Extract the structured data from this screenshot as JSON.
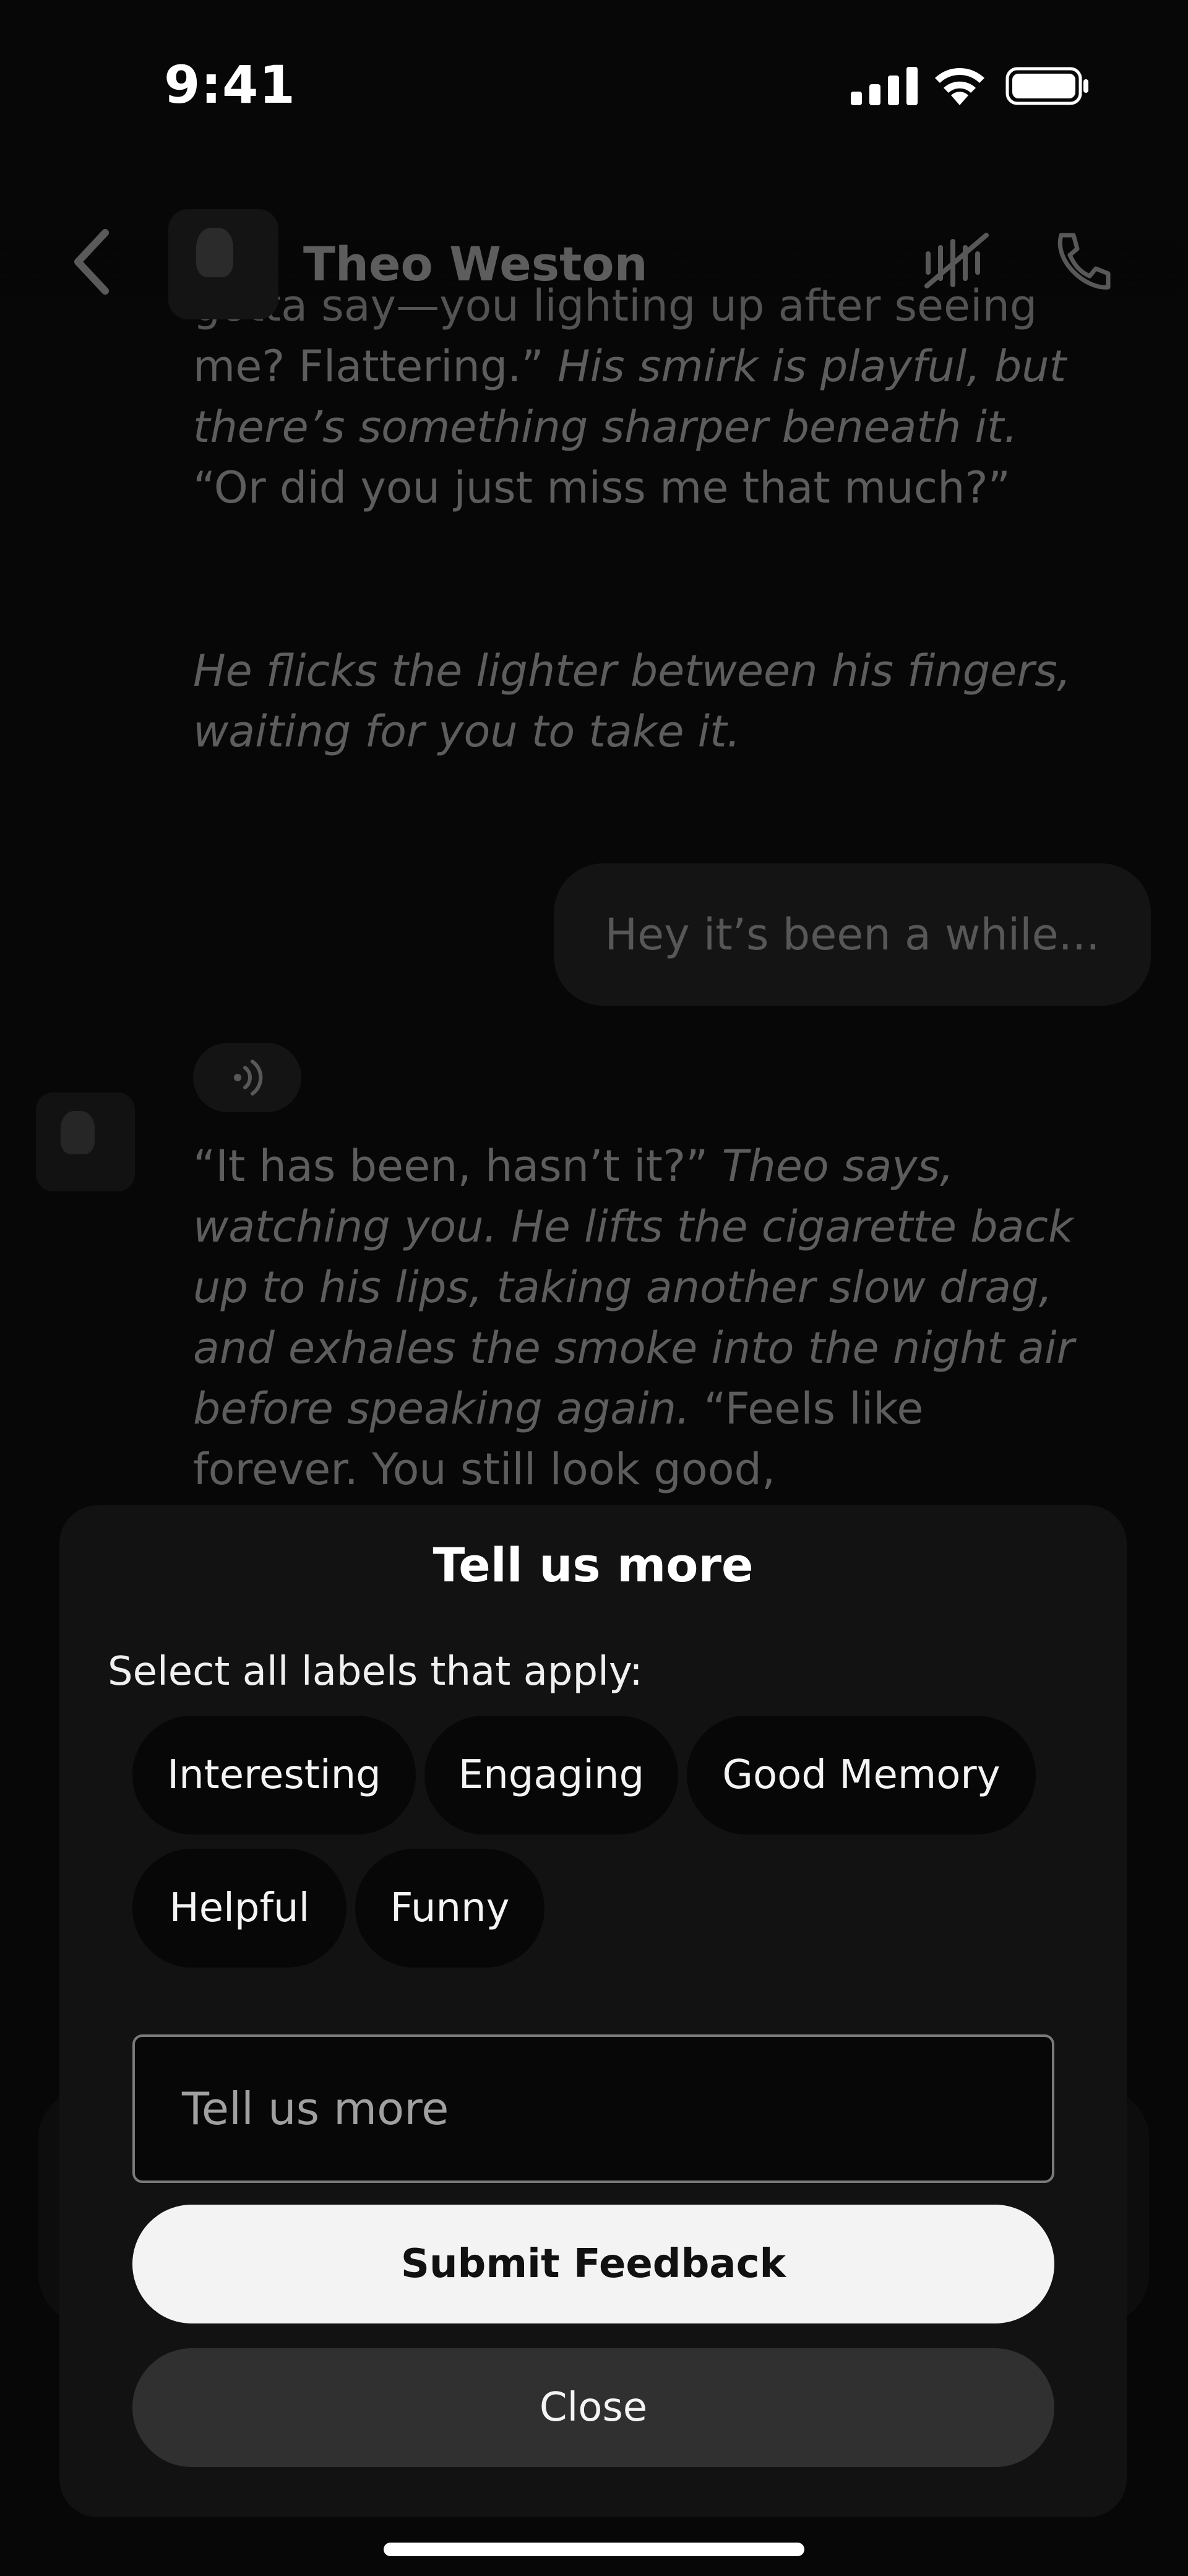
{
  "status_bar": {
    "time": "9:41",
    "icons": [
      "signal-icon",
      "wifi-icon",
      "battery-icon"
    ]
  },
  "header": {
    "back_icon": "chevron-left-icon",
    "name": "Theo Weston",
    "actions": [
      "mute-voice-icon",
      "phone-call-icon"
    ]
  },
  "chat": {
    "msg1_clip": "gotta say—you lighting up after seeing",
    "msg1_a": "me? Flattering.”",
    "msg1_b": "His smirk is playful, but there’s something sharper beneath it.",
    "msg1_c": "“Or did you just miss me that much?”",
    "msg2": "He flicks the lighter between his fingers, waiting for you to take it.",
    "user_message": "Hey it’s been a while...",
    "msg3_a": "“It has been, hasn’t it?”",
    "msg3_b": "Theo says, watching you. He lifts the cigarette back up to his lips, taking another slow drag, and exhales the smoke into the night air before speaking again.",
    "msg3_c": "“Feels like forever. You still look good,"
  },
  "feedback": {
    "title": "Tell us more",
    "prompt": "Select all labels that apply:",
    "labels": [
      "Interesting",
      "Engaging",
      "Good Memory",
      "Helpful",
      "Funny"
    ],
    "input_placeholder": "Tell us more",
    "submit_label": "Submit Feedback",
    "close_label": "Close"
  },
  "colors": {
    "background": "#070707",
    "sheet": "#121212",
    "chip": "#070707",
    "submit_bg": "#f3f3f3",
    "close_bg": "#303030"
  }
}
